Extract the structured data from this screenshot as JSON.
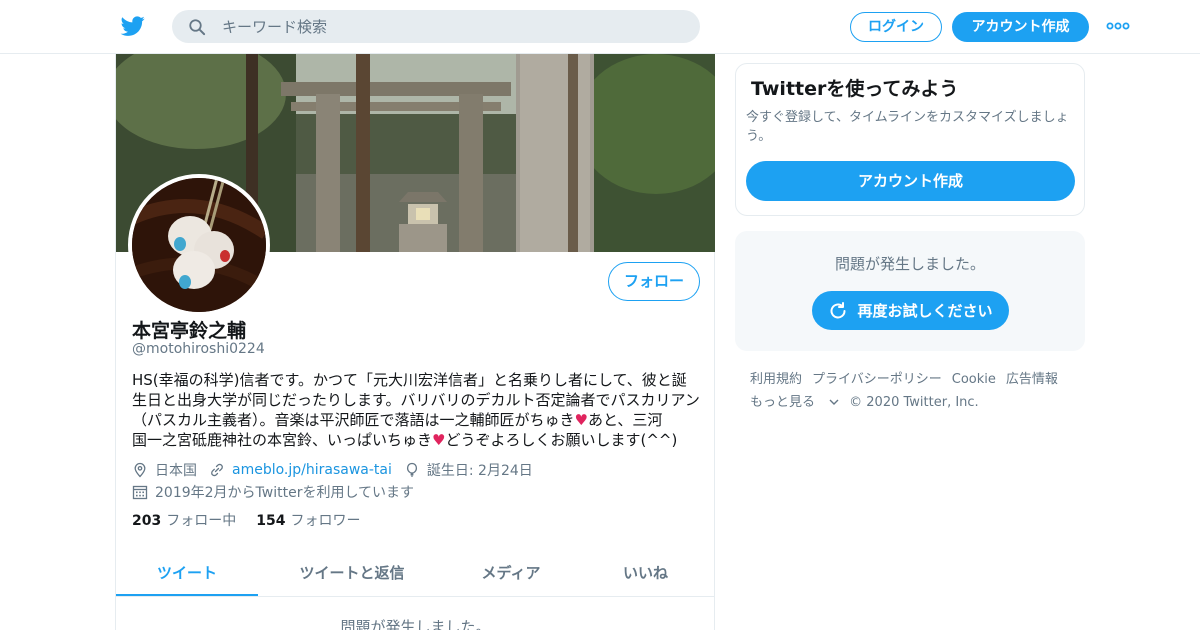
{
  "topnav": {
    "search_placeholder": "キーワード検索",
    "login_label": "ログイン",
    "signup_label": "アカウント作成"
  },
  "profile": {
    "name": "本宮亭鈴之輔",
    "handle": "@motohiroshi0224",
    "follow_label": "フォロー",
    "bio_lines": [
      "HS(幸福の科学)信者です。かつて「元大川宏洋信者」と名乗りし者にして、彼と誕",
      "生日と出身大学が同じだったりします。バリバリのデカルト否定論者でパスカリアン",
      "（パスカル主義者）。音楽は平沢師匠で落語は一之輔師匠がちゅき",
      "あと、三河",
      "国一之宮砥鹿神社の本宮鈴、いっぱいちゅき",
      "どうぞよろしくお願いします(^^)"
    ],
    "heart": "♥",
    "location": "日本国",
    "url": "ameblo.jp/hirasawa-tai",
    "birthday": "誕生日: 2月24日",
    "joined": "2019年2月からTwitterを利用しています",
    "following_count": "203",
    "following_label": "フォロー中",
    "followers_count": "154",
    "followers_label": "フォロワー"
  },
  "tabs": [
    {
      "label": "ツイート",
      "active": true
    },
    {
      "label": "ツイートと返信",
      "active": false
    },
    {
      "label": "メディア",
      "active": false
    },
    {
      "label": "いいね",
      "active": false
    }
  ],
  "timeline_error": "問題が発生しました。",
  "signup_card": {
    "title": "Twitterを使ってみよう",
    "description": "今すぐ登録して、タイムラインをカスタマイズしましょう。",
    "button_label": "アカウント作成"
  },
  "error_box": {
    "message": "問題が発生しました。",
    "retry_label": "再度お試しください"
  },
  "footer": {
    "links": [
      "利用規約",
      "プライバシーポリシー",
      "Cookie",
      "広告情報",
      "もっと見る"
    ],
    "copyright": "© 2020 Twitter, Inc."
  },
  "colors": {
    "accent": "#1da1f2",
    "secondary_text": "#657786",
    "border": "#e6ecf0",
    "heart": "#e0245e"
  }
}
